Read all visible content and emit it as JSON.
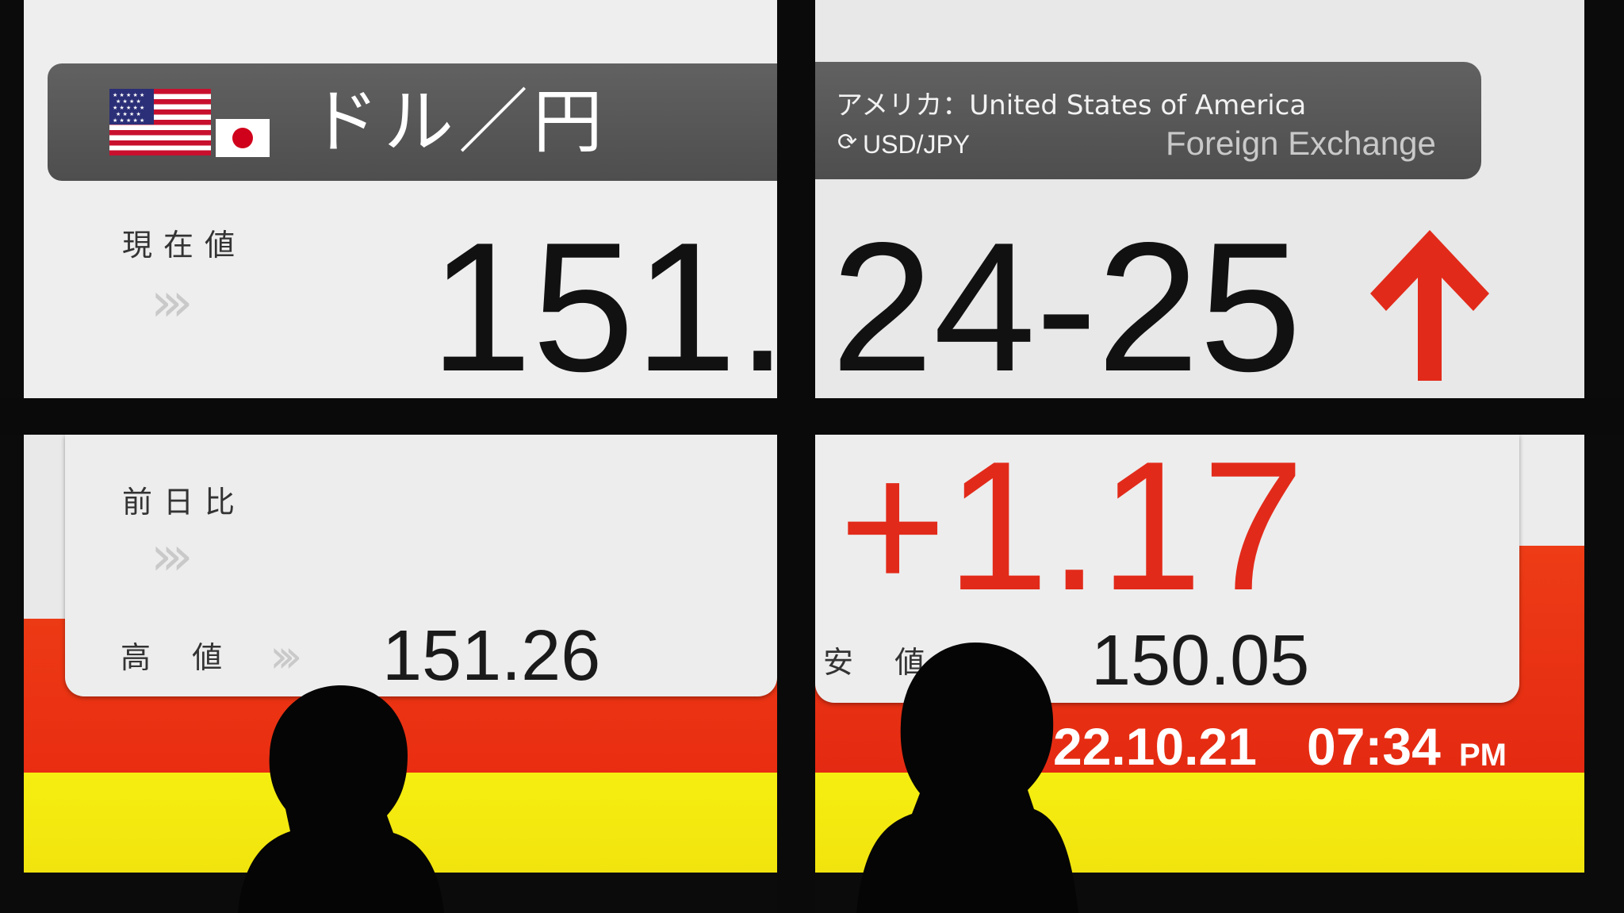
{
  "board": {
    "pair_label": "ドル／円",
    "country_label": "アメリカ：United States of America",
    "ticker": "USD/JPY",
    "category": "Foreign Exchange",
    "current_label": "現在値",
    "current_value_left": "151.",
    "current_value_right": "24-25",
    "change_label": "前日比",
    "change_value": "+1.17",
    "high_label": "高 値",
    "high_value": "151.26",
    "low_label": "安 値",
    "low_value": "150.05",
    "date": "22.10.21",
    "time": "07:34",
    "ampm": "PM",
    "chevrons": "›››",
    "trend": "up",
    "colors": {
      "accent_red": "#e22a1a",
      "band_red": "#ea2d12",
      "band_yellow": "#f6ee10",
      "header_gray": "#575757"
    }
  }
}
